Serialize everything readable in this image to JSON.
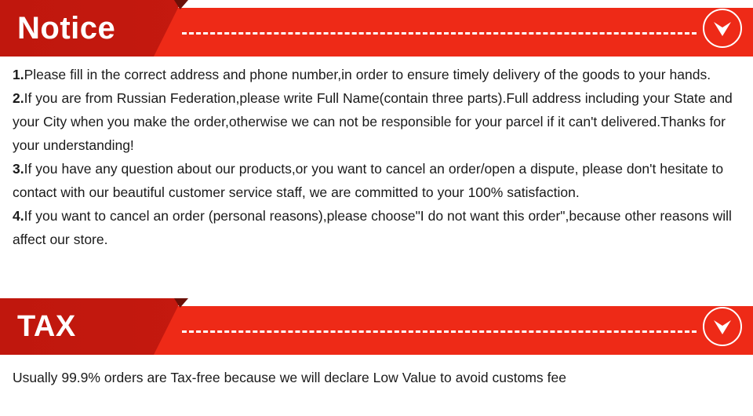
{
  "sections": [
    {
      "id": "notice",
      "title": "Notice",
      "icon": "chevron-down-icon",
      "paragraphs": [
        {
          "num": "1.",
          "text": "Please fill in the correct address and phone number,in order to ensure timely delivery of the goods to your hands."
        },
        {
          "num": "2.",
          "text": "If you are from Russian Federation,please write Full Name(contain three parts).Full address including your State and your City when you make the order,otherwise we can not be responsible for your parcel if it can't delivered.Thanks for your understanding!"
        },
        {
          "num": "3.",
          "text": "If you have any question about our products,or you want to cancel an order/open a dispute, please don't hesitate to contact with our beautiful customer service staff, we are committed to your 100% satisfaction."
        },
        {
          "num": "4.",
          "text": "If you want to cancel an order (personal reasons),please choose\"I do not want this order\",because other reasons will affect our store."
        }
      ]
    },
    {
      "id": "tax",
      "title": "TAX",
      "icon": "chevron-down-icon",
      "paragraphs": [
        {
          "num": "",
          "text": "Usually 99.9% orders are Tax-free because we will declare Low Value to avoid customs fee"
        }
      ]
    }
  ],
  "colors": {
    "banner_bright": "#ee2a17",
    "banner_dark": "#c2180e",
    "notch": "#6b1008",
    "text": "#1a1a1a",
    "white": "#ffffff"
  }
}
